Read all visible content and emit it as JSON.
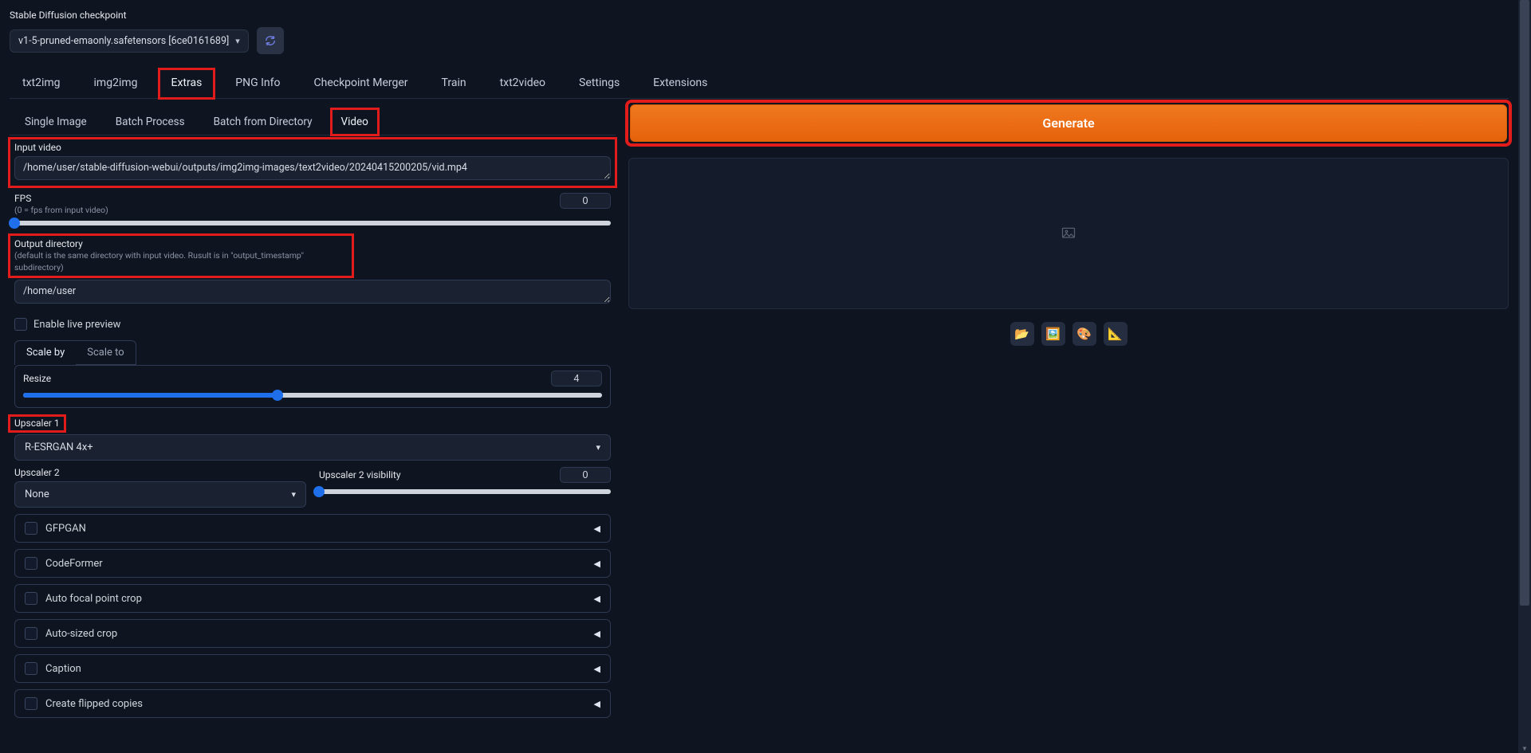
{
  "checkpoint": {
    "label": "Stable Diffusion checkpoint",
    "value": "v1-5-pruned-emaonly.safetensors [6ce0161689]"
  },
  "main_tabs": [
    "txt2img",
    "img2img",
    "Extras",
    "PNG Info",
    "Checkpoint Merger",
    "Train",
    "txt2video",
    "Settings",
    "Extensions"
  ],
  "main_tab_selected": "Extras",
  "sub_tabs": [
    "Single Image",
    "Batch Process",
    "Batch from Directory",
    "Video"
  ],
  "sub_tab_selected": "Video",
  "input_video": {
    "label": "Input video",
    "value": "/home/user/stable-diffusion-webui/outputs/img2img-images/text2video/20240415200205/vid.mp4"
  },
  "fps": {
    "label": "FPS",
    "hint": "(0 = fps from input video)",
    "value": 0,
    "min": 0,
    "max": 60,
    "fill_pct": 0
  },
  "output_dir": {
    "label": "Output directory",
    "hint": "(default is the same directory with input video. Rusult is in \"output_timestamp\" subdirectory)",
    "value": "/home/user"
  },
  "live_preview": {
    "label": "Enable live preview",
    "checked": false
  },
  "scale_tabs": [
    "Scale by",
    "Scale to"
  ],
  "scale_tab_selected": "Scale by",
  "resize": {
    "label": "Resize",
    "value": 4,
    "fill_pct": 44
  },
  "upscaler1": {
    "label": "Upscaler 1",
    "value": "R-ESRGAN 4x+"
  },
  "upscaler2": {
    "label": "Upscaler 2",
    "value": "None"
  },
  "upscaler2_vis": {
    "label": "Upscaler 2 visibility",
    "value": 0,
    "fill_pct": 0
  },
  "accordions": [
    "GFPGAN",
    "CodeFormer",
    "Auto focal point crop",
    "Auto-sized crop",
    "Caption",
    "Create flipped copies"
  ],
  "generate_label": "Generate",
  "out_icons": [
    "📂",
    "🖼️",
    "🎨",
    "📐"
  ]
}
